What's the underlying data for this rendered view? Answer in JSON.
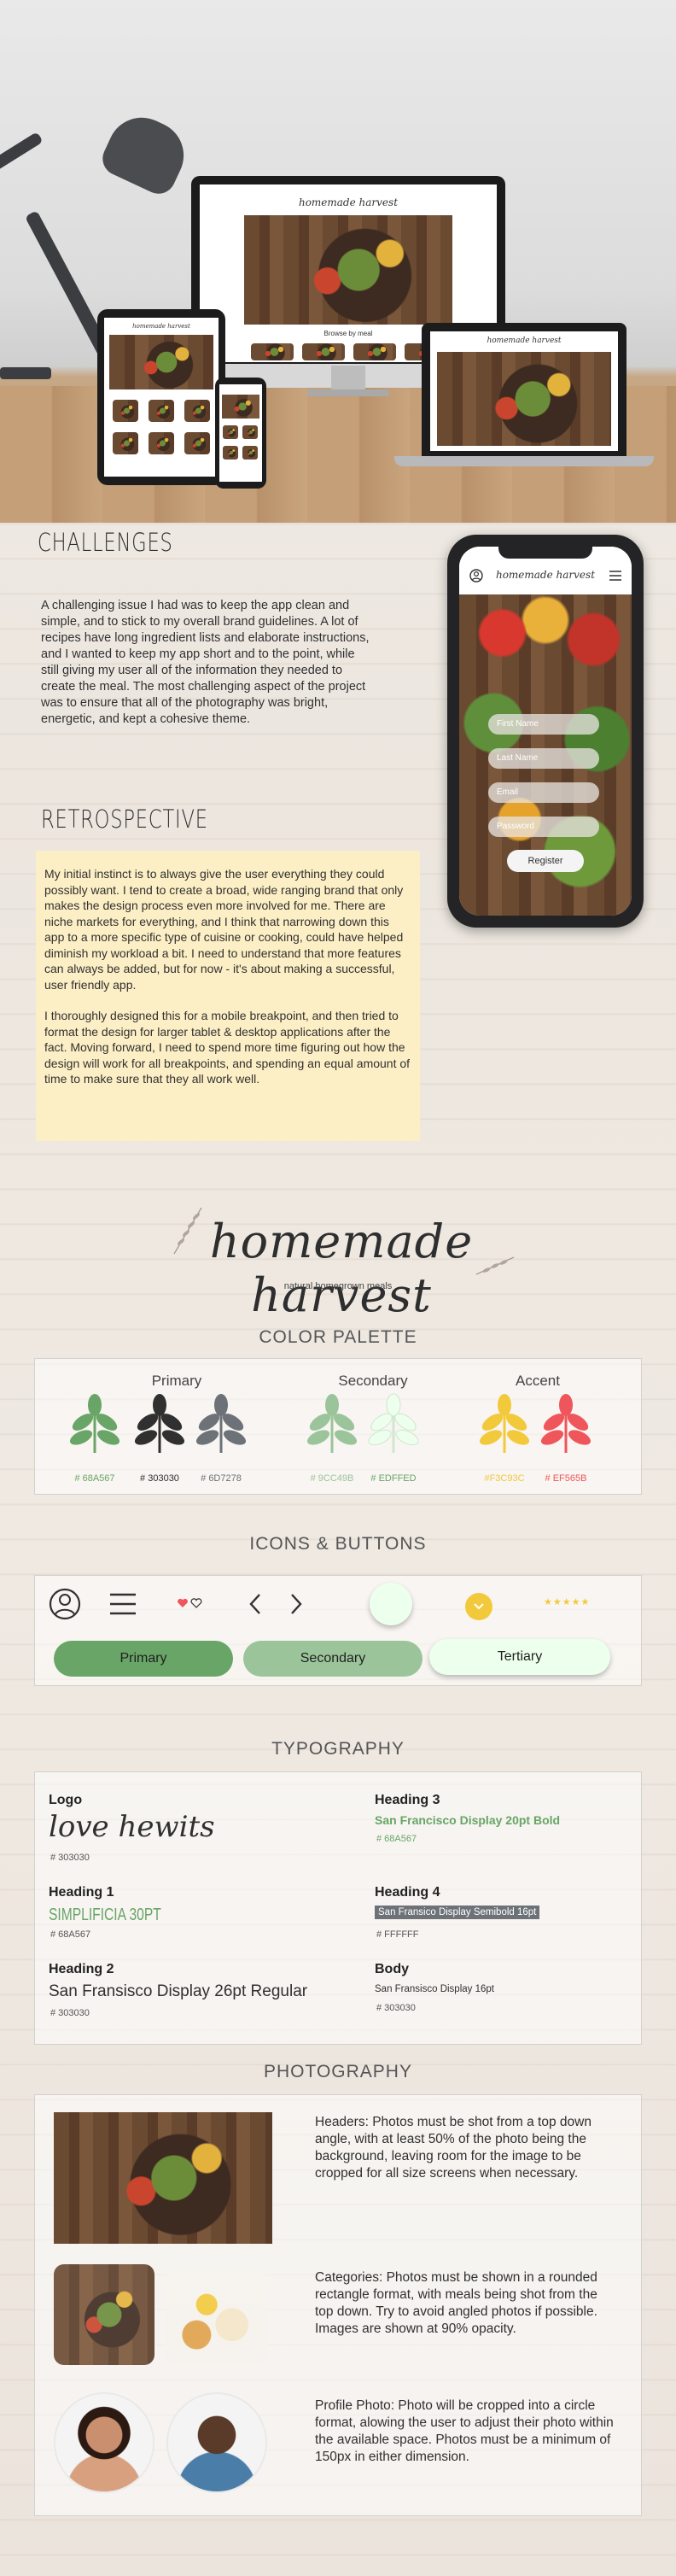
{
  "mockups": {
    "desktop_logo": "homemade harvest",
    "desktop_sub": "Browse by meal",
    "tablet_logo": "homemade harvest",
    "laptop_logo": "homemade harvest",
    "phone_logo": "homemade harvest"
  },
  "phone_form": {
    "fields": [
      "First Name",
      "Last Name",
      "Email",
      "Password"
    ],
    "register_label": "Register"
  },
  "challenges": {
    "title": "CHALLENGES",
    "body": "A challenging issue I had was to keep the app clean and simple, and to stick to my overall brand guidelines. A lot of recipes have long ingredient lists and elaborate instructions, and I wanted to keep my app short and to the point, while still giving my user all of the information they needed to create the meal. The most challenging aspect of the project was to ensure that all of the photography was bright, energetic, and kept a cohesive theme."
  },
  "retrospective": {
    "title": "RETROSPECTIVE",
    "para1": "My initial instinct is to always give the user everything they could possibly want.  I tend to create a broad, wide ranging brand that only makes the design process even more involved for me. There are niche markets for everything, and I think that narrowing down this app to a more specific type of cuisine or cooking, could have helped diminish my workload a bit. I need to understand that more features can always be added, but for now - it's about making a successful, user friendly app.",
    "para2": "I thoroughly designed this for a mobile breakpoint, and then tried to format the design for larger tablet & desktop applications after the fact. Moving forward, I need to spend more time figuring out how the design will work for all breakpoints, and spending an equal amount of time to make sure that they all work well."
  },
  "brand": {
    "logo": "homemade harvest",
    "tagline": "natural homegrown meals"
  },
  "color_palette": {
    "title": "COLOR PALETTE",
    "groups": [
      {
        "label": "Primary",
        "swatches": [
          {
            "hex": "# 68A567",
            "color": "#68A567"
          },
          {
            "hex": "# 303030",
            "color": "#303030"
          },
          {
            "hex": "# 6D7278",
            "color": "#6D7278"
          }
        ]
      },
      {
        "label": "Secondary",
        "swatches": [
          {
            "hex": "# 9CC49B",
            "color": "#9CC49B"
          },
          {
            "hex": "# EDFFED",
            "color": "#EDFFED"
          }
        ]
      },
      {
        "label": "Accent",
        "swatches": [
          {
            "hex": "#F3C93C",
            "color": "#F3C93C"
          },
          {
            "hex": "# EF565B",
            "color": "#EF565B"
          }
        ]
      }
    ]
  },
  "icons_buttons": {
    "title": "ICONS & BUTTONS",
    "primary_label": "Primary",
    "secondary_label": "Secondary",
    "tertiary_label": "Tertiary",
    "stars": "★★★★★"
  },
  "typography": {
    "title": "TYPOGRAPHY",
    "logo": {
      "label": "Logo",
      "sample": "love hewits",
      "hex": "# 303030"
    },
    "h1": {
      "label": "Heading 1",
      "sample": "SIMPLIFICIA 30PT",
      "hex": "# 68A567"
    },
    "h2": {
      "label": "Heading 2",
      "sample": "San Fransisco Display 26pt Regular",
      "hex": "# 303030"
    },
    "h3": {
      "label": "Heading 3",
      "sample": "San Francisco Display 20pt Bold",
      "hex": "# 68A567"
    },
    "h4": {
      "label": "Heading 4",
      "sample": "San Fransico Display Semibold 16pt",
      "hex": "# FFFFFF"
    },
    "body": {
      "label": "Body",
      "sample": "San Fransisco Display 16pt",
      "hex": "# 303030"
    }
  },
  "photography": {
    "title": "PHOTOGRAPHY",
    "headers": "Headers: Photos must be shot from a top down angle, with at least 50% of the photo being the background, leaving room for the image to be cropped for all size screens when necessary.",
    "categories": "Categories: Photos must be shown in a rounded rectangle format, with meals being shot from the top down. Try to avoid angled photos if possible. Images are shown at 90% opacity.",
    "profile": "Profile Photo: Photo will be cropped into a circle format, alowing the user to adjust their photo within the available space. Photos must be a minimum of 150px in either dimension."
  }
}
